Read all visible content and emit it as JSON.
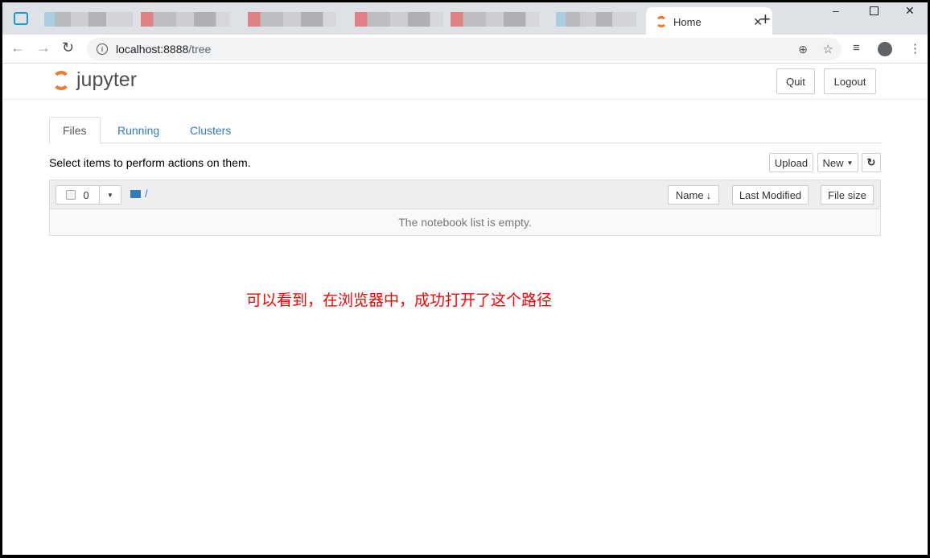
{
  "browser": {
    "active_tab": {
      "title": "Home",
      "icon": "jupyter-favicon"
    },
    "url": {
      "host": "localhost:8888",
      "path": "/tree"
    },
    "icons": [
      "back-icon",
      "forward-icon",
      "reload-icon",
      "info-icon",
      "zoom-icon",
      "star-icon",
      "media-icon",
      "profile-icon",
      "menu-icon"
    ]
  },
  "header": {
    "logo_text": "jupyter",
    "quit": "Quit",
    "logout": "Logout"
  },
  "tabs": [
    {
      "label": "Files"
    },
    {
      "label": "Running"
    },
    {
      "label": "Clusters"
    }
  ],
  "toolbar": {
    "hint": "Select items to perform actions on them.",
    "upload": "Upload",
    "new": "New",
    "refresh_icon": "refresh-icon"
  },
  "list": {
    "selected_count": "0",
    "path": "/",
    "columns": [
      "Name",
      "Last Modified",
      "File size"
    ],
    "empty": "The notebook list is empty."
  },
  "annotation": "可以看到，在浏览器中，成功打开了这个路径",
  "colors": {
    "accent": "#337ab7",
    "logo_orange": "#f37726",
    "annotation": "#ff0000"
  }
}
